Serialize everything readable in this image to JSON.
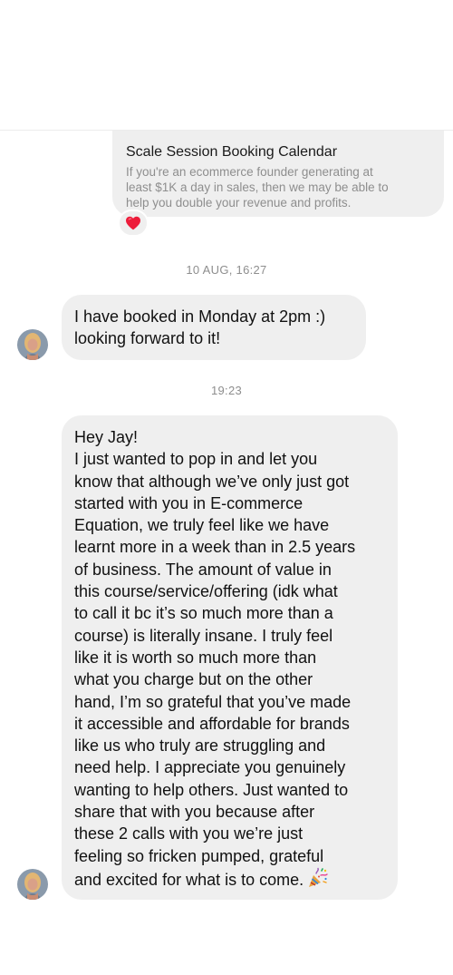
{
  "link_preview": {
    "title": "Scale Session Booking Calendar",
    "description_lines": [
      "If you're an ecommerce founder generating at",
      "least $1K a day in sales, then we may be able to",
      "help you double your revenue and profits."
    ],
    "reaction_icon": "red-heart-icon",
    "reaction_color": "#ed1c3a"
  },
  "timestamps": [
    "10 AUG, 16:27",
    "19:23"
  ],
  "messages": [
    {
      "lines": [
        "I have booked in Monday at 2pm :)",
        "looking forward to it!"
      ]
    },
    {
      "lines": [
        "Hey Jay!",
        "I just wanted to pop in and let you",
        "know that although we’ve only just got",
        "started with you in E-commerce",
        "Equation, we truly feel like we have",
        "learnt more in a week than in 2.5 years",
        "of business. The amount of value in",
        "this course/service/offering (idk what",
        "to call it bc it’s so much more than a",
        "course) is literally insane. I truly feel",
        "like it is worth so much more than",
        "what you charge but on the other",
        "hand, I’m so grateful that you’ve made",
        "it accessible and affordable for brands",
        "like us who truly are struggling and",
        "need help. I appreciate you genuinely",
        "wanting to help others. Just wanted to",
        "share that with you because after",
        "these 2 calls with you we’re just",
        "feeling so fricken pumped, grateful",
        "and excited for what is to come."
      ],
      "trailing_icon": "party-popper-icon"
    }
  ],
  "colors": {
    "bubble_background": "#efefef",
    "secondary_text": "#8e8e8e"
  }
}
